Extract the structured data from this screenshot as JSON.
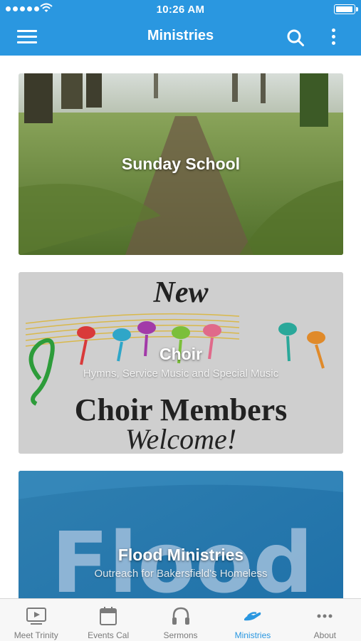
{
  "status_bar": {
    "time": "10:26 AM",
    "battery_level": 1.0
  },
  "header": {
    "title": "Ministries",
    "menu_icon": "hamburger-menu-icon",
    "search_icon": "search-icon",
    "more_icon": "more-vertical-icon"
  },
  "cards": [
    {
      "title": "Sunday School",
      "subtitle": "",
      "image": "forest-path-photo"
    },
    {
      "title": "Choir",
      "subtitle": "Hymns, Service Music and Special Music",
      "image": "choir-poster-image",
      "image_text": [
        "New",
        "Choir Members",
        "Welcome!"
      ]
    },
    {
      "title": "Flood Ministries",
      "subtitle": "Outreach for Bakersfield's Homeless",
      "image": "flood-logo-image",
      "image_text": [
        "Flood"
      ]
    }
  ],
  "tabs": [
    {
      "label": "Meet Trinity",
      "icon": "video-player-icon",
      "active": false
    },
    {
      "label": "Events Cal",
      "icon": "calendar-icon",
      "active": false
    },
    {
      "label": "Sermons",
      "icon": "headphones-icon",
      "active": false
    },
    {
      "label": "Ministries",
      "icon": "helping-hands-icon",
      "active": true
    },
    {
      "label": "About",
      "icon": "more-horizontal-icon",
      "active": false
    }
  ],
  "colors": {
    "brand": "#2a97e0",
    "tab_inactive": "#7a7a7a",
    "tab_bar_bg": "#f7f7f7"
  }
}
